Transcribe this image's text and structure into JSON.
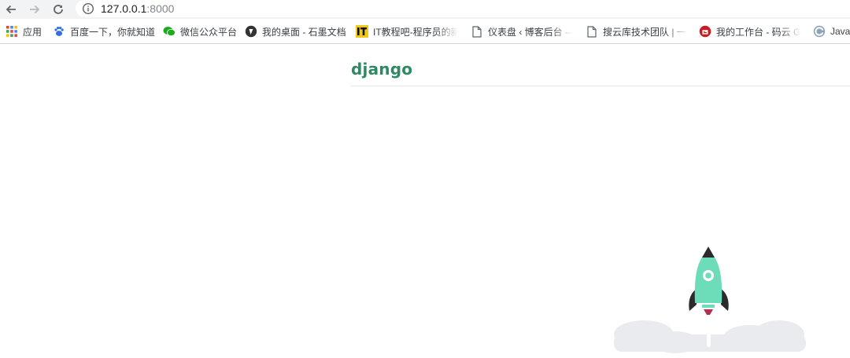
{
  "browser": {
    "url_host": "127.0.0.1",
    "url_port": ":8000",
    "icons": {
      "back": "arrow-left-icon",
      "forward": "arrow-right-icon",
      "reload": "reload-icon",
      "info": "info-icon"
    }
  },
  "bookmarks": [
    {
      "label": "应用",
      "icon": "apps-grid-icon"
    },
    {
      "label": "百度一下，你就知道",
      "icon": "baidu-paw-icon"
    },
    {
      "label": "微信公众平台",
      "icon": "wechat-icon"
    },
    {
      "label": "我的桌面 - 石墨文档",
      "icon": "shimo-icon"
    },
    {
      "label": "IT教程吧-程序员的新",
      "icon": "it-logo-icon"
    },
    {
      "label": "仪表盘 ‹ 博客后台 —",
      "icon": "page-icon"
    },
    {
      "label": "搜云库技术团队 | 一个",
      "icon": "page-icon"
    },
    {
      "label": "我的工作台 - 码云 Gi",
      "icon": "gitee-icon"
    },
    {
      "label": "Java",
      "icon": "c-logo-icon"
    }
  ],
  "page": {
    "logo_text": "django"
  },
  "colors": {
    "django_green": "#2e8a63",
    "rocket_body": "#6dddb9",
    "rocket_dark": "#2b2b2b",
    "cloud": "#e9ebef"
  }
}
